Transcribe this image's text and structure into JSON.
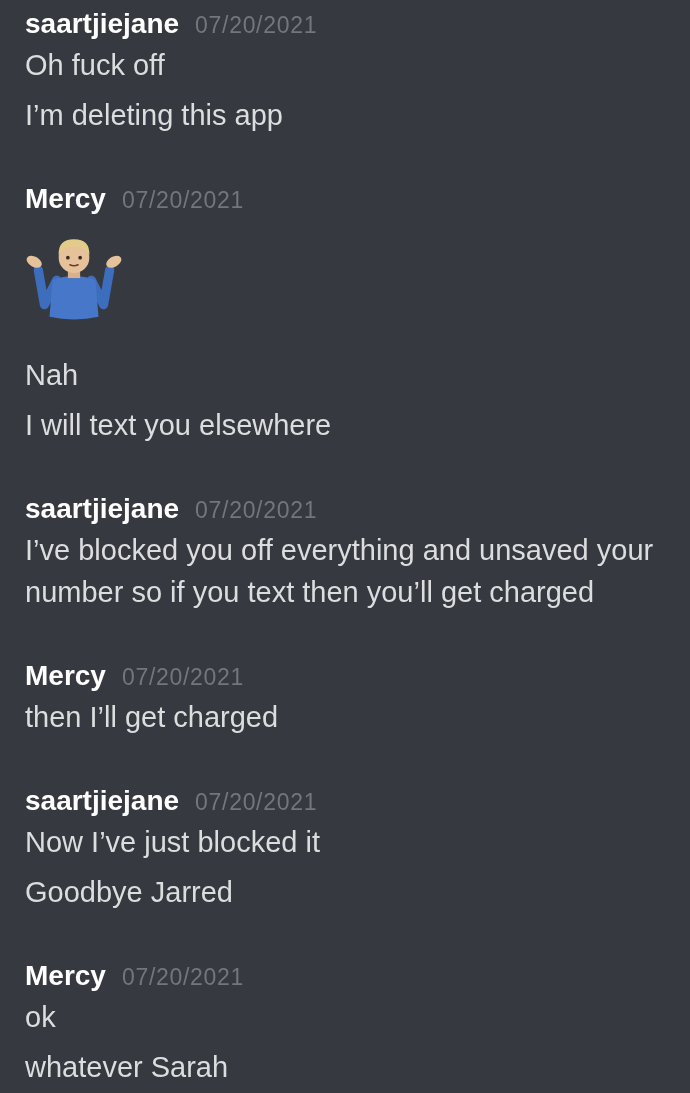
{
  "messages": [
    {
      "author": "saartjiejane",
      "timestamp": "07/20/2021",
      "items": [
        {
          "kind": "text",
          "text": "Oh fuck off"
        },
        {
          "kind": "text",
          "text": "I’m deleting this app"
        }
      ]
    },
    {
      "author": "Mercy",
      "timestamp": "07/20/2021",
      "items": [
        {
          "kind": "emoji"
        },
        {
          "kind": "text",
          "text": "Nah"
        },
        {
          "kind": "text",
          "text": "I will text you elsewhere"
        }
      ]
    },
    {
      "author": "saartjiejane",
      "timestamp": "07/20/2021",
      "items": [
        {
          "kind": "text",
          "text": "I’ve blocked you off everything and unsaved your number so if you text then you’ll get charged"
        }
      ]
    },
    {
      "author": "Mercy",
      "timestamp": "07/20/2021",
      "items": [
        {
          "kind": "text",
          "text": "then I’ll get charged"
        }
      ]
    },
    {
      "author": "saartjiejane",
      "timestamp": "07/20/2021",
      "items": [
        {
          "kind": "text",
          "text": "Now I’ve just blocked it"
        },
        {
          "kind": "text",
          "text": "Goodbye Jarred"
        }
      ]
    },
    {
      "author": "Mercy",
      "timestamp": "07/20/2021",
      "items": [
        {
          "kind": "text",
          "text": "ok"
        },
        {
          "kind": "text",
          "text": "whatever Sarah"
        }
      ]
    }
  ]
}
